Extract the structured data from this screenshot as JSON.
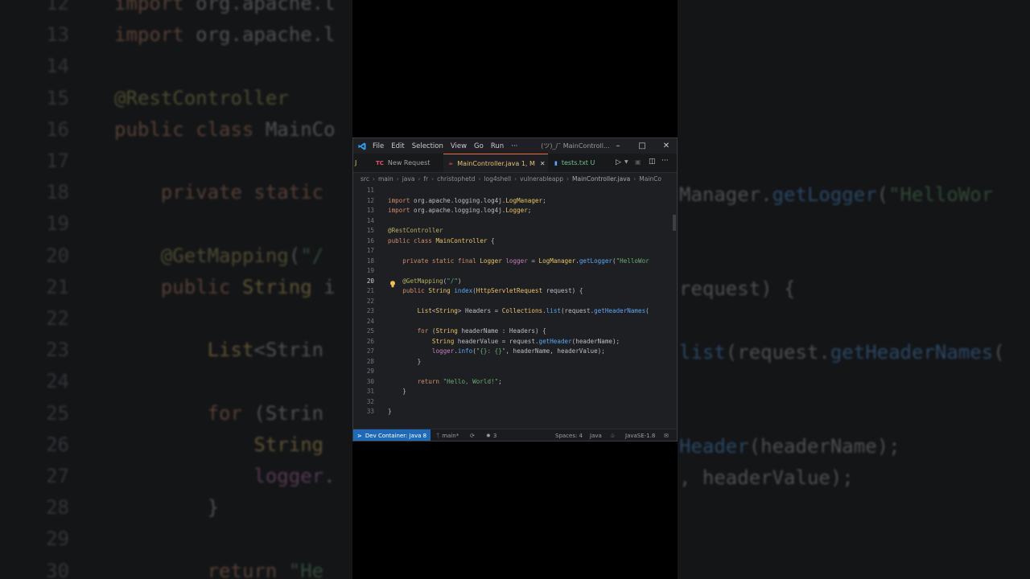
{
  "window": {
    "title": "(ツ)_/¯ MainControll...",
    "menu": [
      "File",
      "Edit",
      "Selection",
      "View",
      "Go",
      "Run",
      "···"
    ]
  },
  "tabs": [
    {
      "label": "J",
      "icon": "java-icon"
    },
    {
      "label": "New Request",
      "icon": "TC"
    },
    {
      "label": "MainController.java 1, M",
      "icon": "java-icon"
    },
    {
      "label": "tests.txt U",
      "icon": "file-icon"
    }
  ],
  "breadcrumb": [
    "src",
    "main",
    "java",
    "fr",
    "christophetd",
    "log4shell",
    "vulnerableapp",
    "MainController.java",
    "MainCo"
  ],
  "editor": {
    "current_line": 20,
    "lines": [
      {
        "n": "11",
        "code": ""
      },
      {
        "n": "12",
        "code": "import org.apache.logging.log4j.LogManager;"
      },
      {
        "n": "13",
        "code": "import org.apache.logging.log4j.Logger;"
      },
      {
        "n": "14",
        "code": ""
      },
      {
        "n": "15",
        "code": "@RestController"
      },
      {
        "n": "16",
        "code": "public class MainController {"
      },
      {
        "n": "17",
        "code": ""
      },
      {
        "n": "18",
        "code": "    private static final Logger logger = LogManager.getLogger(\"HelloWor"
      },
      {
        "n": "19",
        "code": ""
      },
      {
        "n": "20",
        "code": "    @GetMapping(\"/\")"
      },
      {
        "n": "21",
        "code": "    public String index(HttpServletRequest request) {"
      },
      {
        "n": "22",
        "code": ""
      },
      {
        "n": "23",
        "code": "        List<String> Headers = Collections.list(request.getHeaderNames("
      },
      {
        "n": "24",
        "code": ""
      },
      {
        "n": "25",
        "code": "        for (String headerName : Headers) {"
      },
      {
        "n": "26",
        "code": "            String headerValue = request.getHeader(headerName);"
      },
      {
        "n": "27",
        "code": "            logger.info(\"{}: {}\", headerName, headerValue);"
      },
      {
        "n": "28",
        "code": "        }"
      },
      {
        "n": "29",
        "code": ""
      },
      {
        "n": "30",
        "code": "        return \"Hello, World!\";"
      },
      {
        "n": "31",
        "code": "    }"
      },
      {
        "n": "32",
        "code": ""
      },
      {
        "n": "33",
        "code": "}"
      }
    ]
  },
  "statusbar": {
    "remote": "Dev Container: Java 8",
    "branch": "main*",
    "problems": "3",
    "spaces": "Spaces: 4",
    "language": "Java",
    "jdk": "JavaSE-1.8"
  },
  "background_left": {
    "lines": [
      {
        "n": "12",
        "code": "import org.apache.l"
      },
      {
        "n": "13",
        "code": "import org.apache.l"
      },
      {
        "n": "14",
        "code": ""
      },
      {
        "n": "15",
        "code": "@RestController"
      },
      {
        "n": "16",
        "code": "public class MainCo"
      },
      {
        "n": "17",
        "code": ""
      },
      {
        "n": "18",
        "code": "    private static"
      },
      {
        "n": "19",
        "code": ""
      },
      {
        "n": "20",
        "code": "    @GetMapping(\"/"
      },
      {
        "n": "21",
        "code": "    public String i"
      },
      {
        "n": "22",
        "code": ""
      },
      {
        "n": "23",
        "code": "        List<Strin"
      },
      {
        "n": "24",
        "code": ""
      },
      {
        "n": "25",
        "code": "        for (Strin"
      },
      {
        "n": "26",
        "code": "            String"
      },
      {
        "n": "27",
        "code": "            logger."
      },
      {
        "n": "28",
        "code": "        }"
      },
      {
        "n": "29",
        "code": ""
      },
      {
        "n": "30",
        "code": "        return \"He"
      }
    ]
  },
  "background_right": {
    "lines": [
      {
        "code": "Manager.getLogger(\"HelloWor"
      },
      {
        "code": "request) {"
      },
      {
        "code": "list(request.getHeaderNames("
      },
      {
        "code": "Header(headerName);"
      },
      {
        "code": ", headerValue);"
      }
    ]
  }
}
